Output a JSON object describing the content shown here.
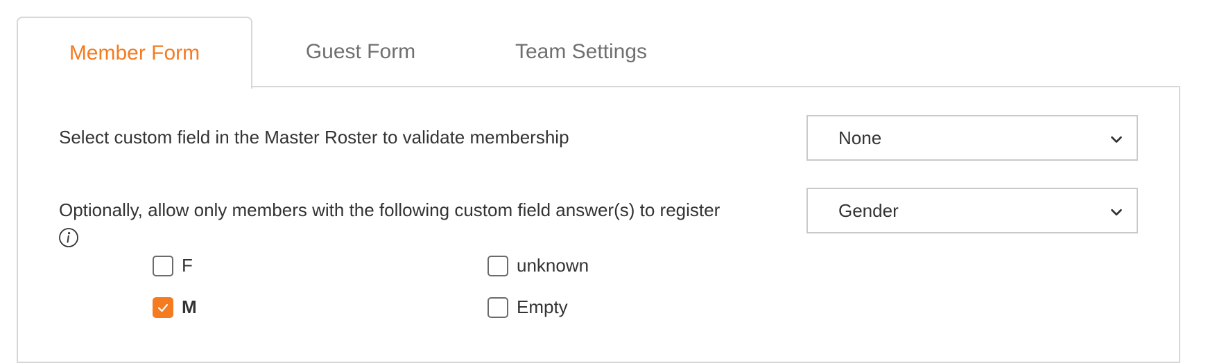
{
  "tabs": [
    {
      "label": "Member Form",
      "active": true
    },
    {
      "label": "Guest Form",
      "active": false
    },
    {
      "label": "Team Settings",
      "active": false
    }
  ],
  "validate_field": {
    "label": "Select custom field in the Master Roster to validate membership",
    "selected": "None"
  },
  "restrict_field": {
    "label": "Optionally, allow only members with the following custom field answer(s) to register",
    "selected": "Gender",
    "options": [
      {
        "label": "F",
        "checked": false
      },
      {
        "label": "M",
        "checked": true
      },
      {
        "label": "unknown",
        "checked": false
      },
      {
        "label": "Empty",
        "checked": false
      }
    ]
  },
  "colors": {
    "accent": "#f47b20",
    "border": "#d7d7d7",
    "text": "#333333",
    "muted": "#6f6f6f"
  },
  "icons": {
    "info": "info-icon",
    "dropdown": "chevron-down-icon",
    "check": "checkmark-icon"
  }
}
